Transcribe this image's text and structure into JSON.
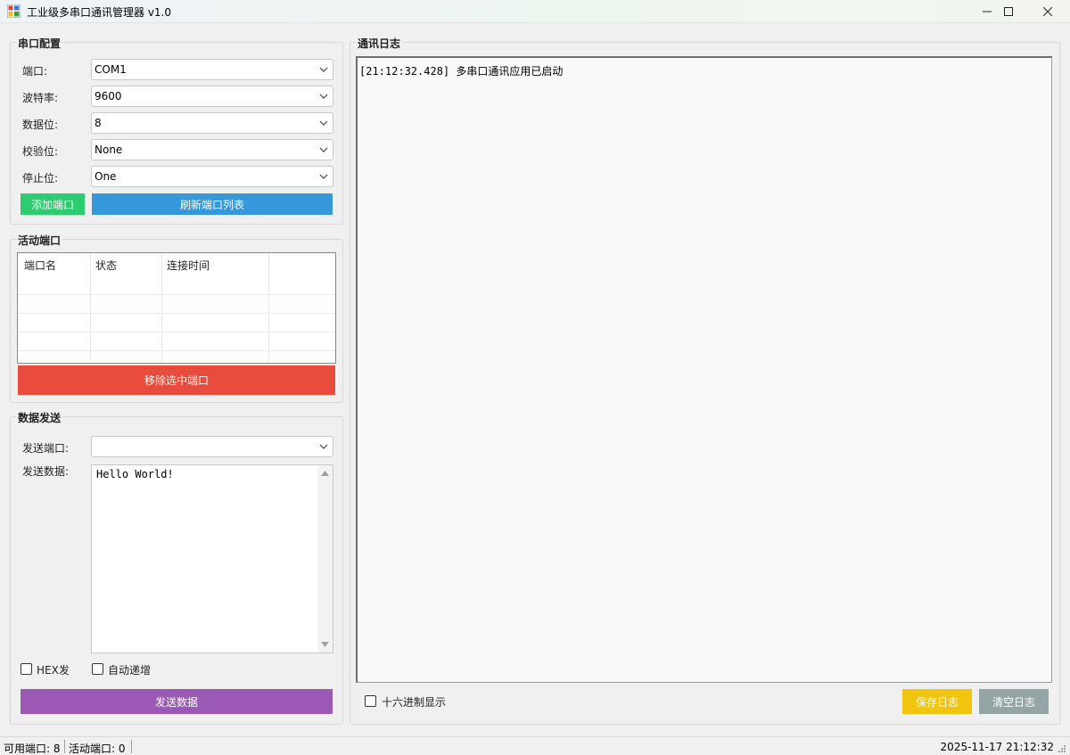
{
  "window": {
    "title": "工业级多串口通讯管理器 v1.0"
  },
  "config": {
    "group_title": "串口配置",
    "fields": [
      {
        "label": "端口:",
        "value": "COM1"
      },
      {
        "label": "波特率:",
        "value": "9600"
      },
      {
        "label": "数据位:",
        "value": "8"
      },
      {
        "label": "校验位:",
        "value": "None"
      },
      {
        "label": "停止位:",
        "value": "One"
      }
    ],
    "add_button": "添加端口",
    "refresh_button": "刷新端口列表"
  },
  "active_ports": {
    "group_title": "活动端口",
    "columns": [
      "端口名",
      "状态",
      "连接时间"
    ],
    "rows": [],
    "remove_button": "移除选中端口"
  },
  "send": {
    "group_title": "数据发送",
    "port_label": "发送端口:",
    "port_value": "",
    "data_label": "发送数据:",
    "data_value": "Hello World!",
    "hex_label": "HEX发",
    "auto_inc_label": "自动递增",
    "send_button": "发送数据"
  },
  "log": {
    "group_title": "通讯日志",
    "entries": [
      "[21:12:32.428] 多串口通讯应用已启动"
    ],
    "hex_display_label": "十六进制显示",
    "save_button": "保存日志",
    "clear_button": "清空日志"
  },
  "status": {
    "available": "可用端口: 8",
    "active": "活动端口: 0",
    "datetime": "2025-11-17 21:12:32"
  },
  "colors": {
    "green": "#2ecc71",
    "blue": "#3498db",
    "red": "#e74c3c",
    "purple": "#9b59b6",
    "yellow": "#f1c40f",
    "gray": "#95a5a6"
  },
  "icons": {
    "app": "serial-app-icon",
    "minimize": "minimize-icon",
    "maximize": "maximize-icon",
    "close": "close-icon",
    "dropdown": "chevron-down-icon"
  }
}
